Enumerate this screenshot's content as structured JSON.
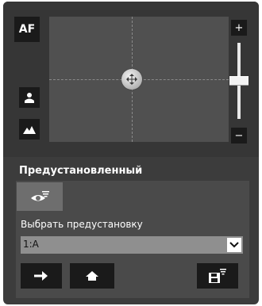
{
  "controls": {
    "af_label": "AF",
    "zoom_in_label": "+",
    "zoom_out_label": "−",
    "zoom_level": 0.5
  },
  "preset": {
    "title": "Предустановленный",
    "select_label": "Выбрать предустановку",
    "selected_value": "1:A"
  },
  "colors": {
    "panel": "#3c3c3c",
    "view": "#505050",
    "button": "#1a1a1a",
    "select": "#8f8f8f"
  }
}
